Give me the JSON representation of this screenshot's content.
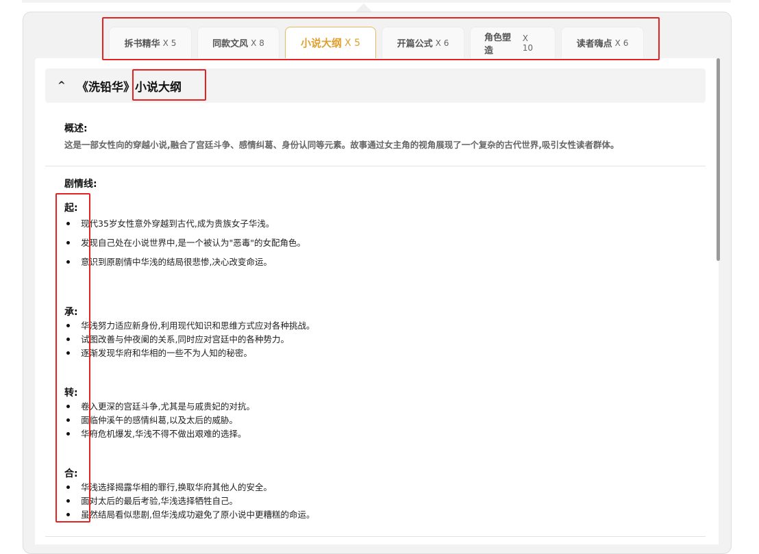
{
  "tabs": [
    {
      "label": "拆书精华",
      "count": "X 5"
    },
    {
      "label": "同款文风",
      "count": "X 8"
    },
    {
      "label": "小说大纲",
      "count": "X 5",
      "active": true
    },
    {
      "label": "开篇公式",
      "count": "X 6"
    },
    {
      "label": "角色塑造",
      "count": "X 10"
    },
    {
      "label": "读者嗨点",
      "count": "X 6"
    }
  ],
  "section": {
    "collapse_icon": "^",
    "book_title": "《洗铅华》",
    "title_suffix": "小说大纲"
  },
  "overview": {
    "label": "概述:",
    "text": "这是一部女性向的穿越小说,融合了宫廷斗争、感情纠葛、身份认同等元素。故事通过女主角的视角展现了一个复杂的古代世界,吸引女性读者群体。"
  },
  "plot": {
    "label": "剧情线:",
    "stages": [
      {
        "label": "起:",
        "points": [
          "现代35岁女性意外穿越到古代,成为贵族女子华浅。",
          "发现自己处在小说世界中,是一个被认为\"恶毒\"的女配角色。",
          "意识到原剧情中华浅的结局很悲惨,决心改变命运。"
        ]
      },
      {
        "label": "承:",
        "points": [
          "华浅努力适应新身份,利用现代知识和思维方式应对各种挑战。",
          "试图改善与仲夜阑的关系,同时应对宫廷中的各种势力。",
          "逐渐发现华府和华相的一些不为人知的秘密。"
        ]
      },
      {
        "label": "转:",
        "points": [
          "卷入更深的宫廷斗争,尤其是与戚贵妃的对抗。",
          "面临仲溪午的感情纠葛,以及太后的威胁。",
          "华府危机爆发,华浅不得不做出艰难的选择。"
        ]
      },
      {
        "label": "合:",
        "points": [
          "华浅选择揭露华相的罪行,换取华府其他人的安全。",
          "面对太后的最后考验,华浅选择牺牲自己。",
          "虽然结局看似悲剧,但华浅成功避免了原小说中更糟糕的命运。"
        ]
      }
    ]
  },
  "colors": {
    "accent": "#e0a030",
    "highlight_box": "#e52222",
    "panel_bg": "#f2f2f2"
  }
}
